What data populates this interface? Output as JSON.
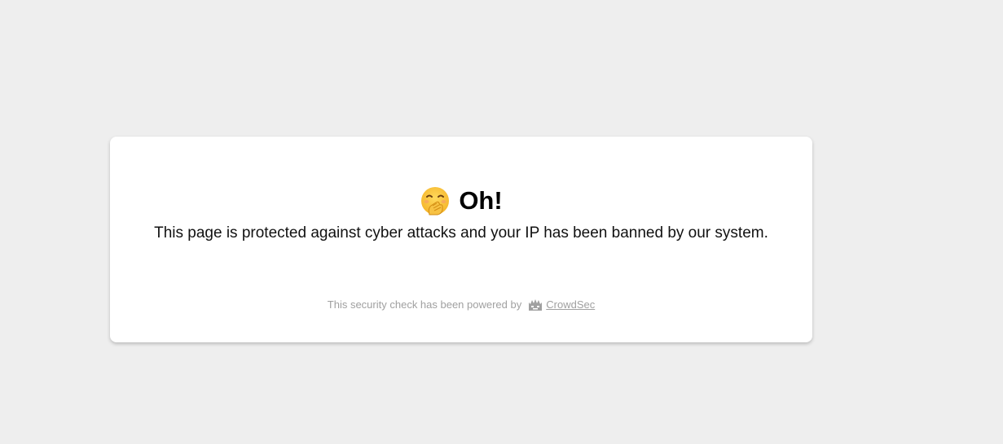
{
  "heading": {
    "icon": "hand-over-mouth-emoji-icon",
    "text": "Oh!"
  },
  "message": "This page is protected against cyber attacks and your IP has been banned by our system.",
  "footer": {
    "text": "This security check has been powered by",
    "logo_icon": "crowdsec-logo-icon",
    "link_text": "CrowdSec"
  },
  "colors": {
    "background": "#eeeeee",
    "card": "#ffffff",
    "footer_text": "#a0a0a0"
  }
}
